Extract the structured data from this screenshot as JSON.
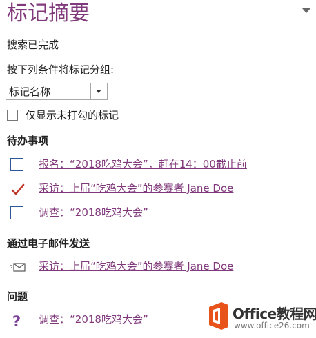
{
  "pane": {
    "title": "标记摘要",
    "status": "搜索已完成",
    "group_label": "按下列条件将标记分组:",
    "group_select": {
      "value": "标记名称"
    },
    "unchecked_only_label": "仅显示未打勾的标记"
  },
  "sections": [
    {
      "heading": "待办事项",
      "items": [
        {
          "text": "报名：“2018吃鸡大会”，赶在14：00截止前",
          "icon": "checkbox-icon",
          "checked": false
        },
        {
          "text": "采访：上届“吃鸡大会”的参赛者 Jane Doe",
          "icon": "checkmark-icon",
          "checked": true
        },
        {
          "text": "调查：“2018吃鸡大会”",
          "icon": "checkbox-icon",
          "checked": false
        }
      ]
    },
    {
      "heading": "通过电子邮件发送",
      "items": [
        {
          "text": "采访：上届“吃鸡大会”的参赛者 Jane Doe",
          "icon": "email-icon"
        }
      ]
    },
    {
      "heading": "问题",
      "items": [
        {
          "text": "调查：“2018吃鸡大会”",
          "icon": "question-icon"
        }
      ]
    }
  ],
  "watermark": {
    "title": "Office教程网",
    "url": "www.office26.com"
  },
  "colors": {
    "accent": "#80397b",
    "checkbox_border": "#2b579a",
    "checkmark": "#c0392b",
    "question": "#7b3f98",
    "logo_orange": "#e8531c"
  }
}
